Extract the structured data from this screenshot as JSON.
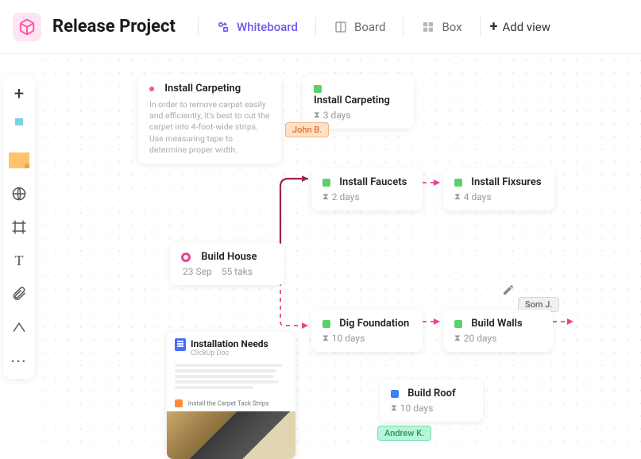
{
  "header": {
    "title": "Release Project",
    "tabs": [
      {
        "label": "Whiteboard",
        "icon": "shapes",
        "active": true
      },
      {
        "label": "Board",
        "icon": "board",
        "active": false
      },
      {
        "label": "Box",
        "icon": "box",
        "active": false
      }
    ],
    "add_view_label": "Add view"
  },
  "toolbar": {
    "tools": [
      "add",
      "highlighter",
      "sticky-note",
      "globe",
      "frame",
      "text",
      "attach",
      "connector",
      "more"
    ]
  },
  "cards": {
    "carpeting_note": {
      "title": "Install Carpeting",
      "description": "In order to remove carpet easily and efficiently, it's best to cut the carpet into 4-foot-wide strips. Use measuring tape to determine proper width."
    },
    "carpeting_task": {
      "title": "Install Carpeting",
      "duration": "3 days",
      "status_color": "#5ad16c"
    },
    "faucets": {
      "title": "Install Faucets",
      "duration": "2 days",
      "status_color": "#5ad16c"
    },
    "fixtures": {
      "title": "Install Fixsures",
      "duration": "4 days",
      "status_color": "#5ad16c"
    },
    "house": {
      "title": "Build House",
      "date": "23 Sep",
      "task_count": "55 taks"
    },
    "foundation": {
      "title": "Dig Foundation",
      "duration": "10 days",
      "status_color": "#5ad16c"
    },
    "walls": {
      "title": "Build Walls",
      "duration": "20 days",
      "status_color": "#5ad16c"
    },
    "roof": {
      "title": "Build Roof",
      "duration": "10 days",
      "status_color": "#3b82f6"
    },
    "doc": {
      "title": "Installation Needs",
      "subtitle": "ClickUp Doc",
      "strip_label": "Install the Carpet Tack Strips"
    }
  },
  "cursors": {
    "john": "John B.",
    "som": "Som J.",
    "andrew": "Andrew K."
  }
}
